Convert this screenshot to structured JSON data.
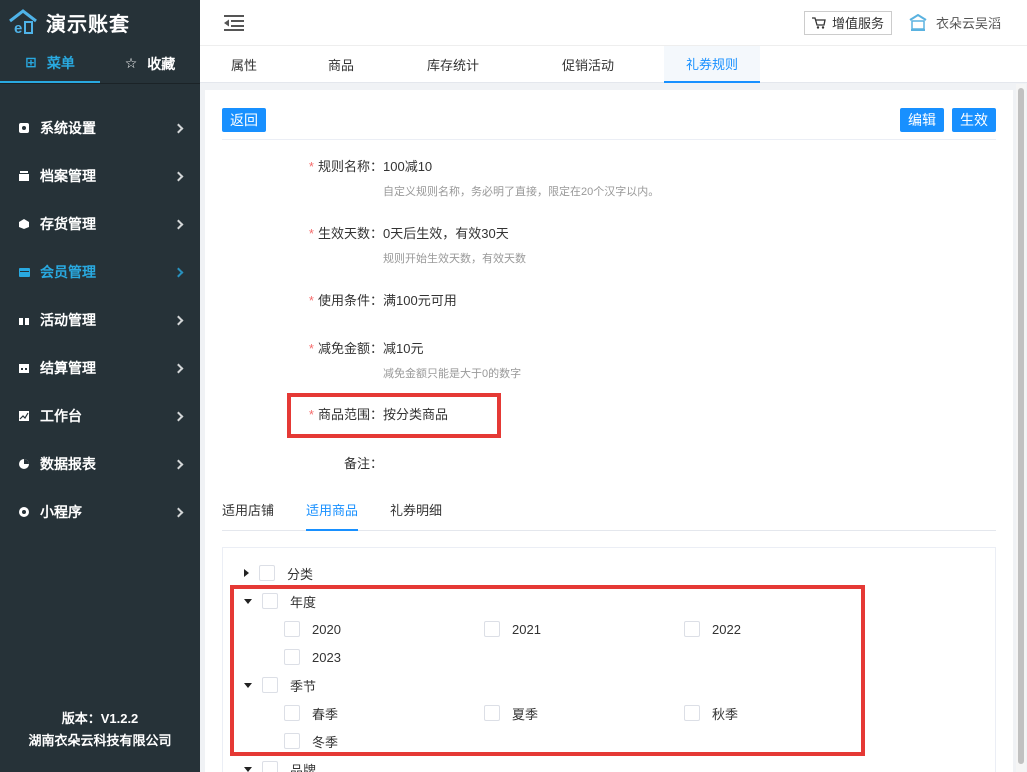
{
  "app": {
    "title": "演示账套"
  },
  "sidebar": {
    "tabs": [
      {
        "label": "菜单",
        "icon": "grid-icon",
        "active": true
      },
      {
        "label": "收藏",
        "icon": "star-icon",
        "active": false
      }
    ],
    "items": [
      {
        "label": "系统设置",
        "icon": "settings-icon"
      },
      {
        "label": "档案管理",
        "icon": "archive-icon"
      },
      {
        "label": "存货管理",
        "icon": "box-icon"
      },
      {
        "label": "会员管理",
        "icon": "member-card-icon",
        "active": true
      },
      {
        "label": "活动管理",
        "icon": "gift-icon"
      },
      {
        "label": "结算管理",
        "icon": "calendar-icon"
      },
      {
        "label": "工作台",
        "icon": "chart-icon"
      },
      {
        "label": "数据报表",
        "icon": "pie-icon"
      },
      {
        "label": "小程序",
        "icon": "miniprogram-icon"
      }
    ],
    "version": "版本：V1.2.2",
    "company": "湖南衣朵云科技有限公司"
  },
  "header": {
    "value_service": "增值服务",
    "user": "衣朵云吴滔"
  },
  "tabs": [
    "属性",
    "商品",
    "库存统计",
    "促销活动",
    "礼券规则"
  ],
  "actions": {
    "back": "返回",
    "edit": "编辑",
    "activate": "生效"
  },
  "form": {
    "rule_name": {
      "label": "规则名称：",
      "value": "100减10",
      "hint": "自定义规则名称，务必明了直接，限定在20个汉字以内。"
    },
    "valid_days": {
      "label": "生效天数：",
      "value": "0天后生效，有效30天",
      "hint": "规则开始生效天数，有效天数"
    },
    "condition": {
      "label": "使用条件：",
      "value": "满100元可用"
    },
    "discount": {
      "label": "减免金额：",
      "value": "减10元",
      "hint": "减免金额只能是大于0的数字"
    },
    "scope": {
      "label": "商品范围：",
      "value": "按分类商品"
    },
    "remark": {
      "label": "备注：",
      "value": ""
    }
  },
  "subtabs": [
    "适用店铺",
    "适用商品",
    "礼券明细"
  ],
  "tree": {
    "category": "分类",
    "year": {
      "label": "年度",
      "children": [
        "2020",
        "2021",
        "2022",
        "2023"
      ]
    },
    "season": {
      "label": "季节",
      "children": [
        "春季",
        "夏季",
        "秋季",
        "冬季"
      ]
    },
    "brand": "品牌"
  },
  "colors": {
    "sidebar": "#263238",
    "accent": "#29a9e0",
    "primary": "#1890ff",
    "highlight": "#e53935",
    "required": "#f56c6c"
  }
}
